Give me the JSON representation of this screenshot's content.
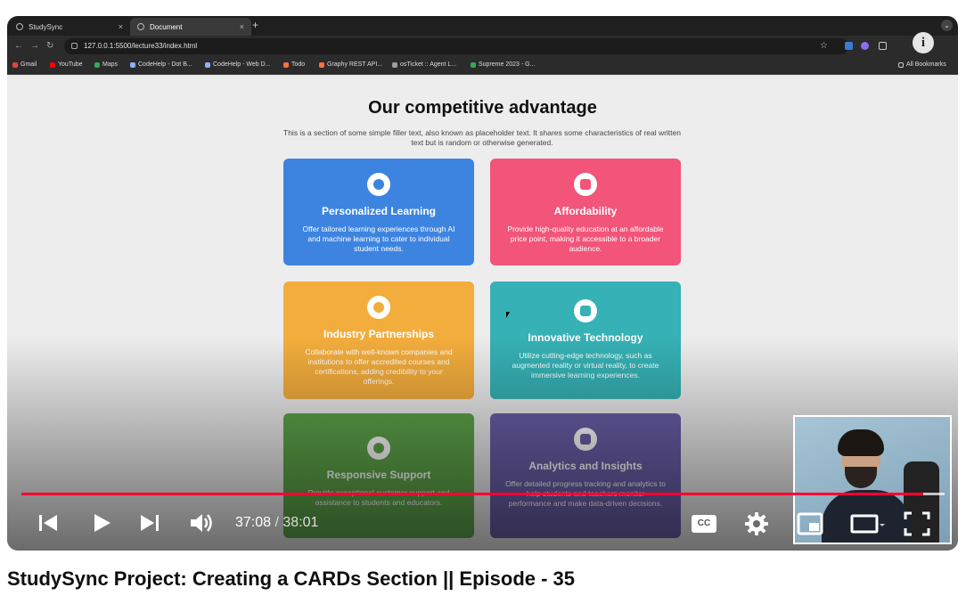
{
  "browser": {
    "tabs": [
      {
        "label": "StudySync",
        "close": "×"
      },
      {
        "label": "Document",
        "close": "×"
      }
    ],
    "new_tab": "+",
    "tab_menu": "⌄",
    "url": "127.0.0.1:5500/lecture33/index.html",
    "bookmarks": [
      {
        "label": "Gmail",
        "color": "#ea4335"
      },
      {
        "label": "YouTube",
        "color": "#ff0000"
      },
      {
        "label": "Maps",
        "color": "#34a853"
      },
      {
        "label": "CodeHelp - Dot B...",
        "color": "#8ab4f8"
      },
      {
        "label": "CodeHelp - Web D...",
        "color": "#8ab4f8"
      },
      {
        "label": "Todo",
        "color": "#ff7043"
      },
      {
        "label": "Graphy REST API...",
        "color": "#ff7043"
      },
      {
        "label": "osTicket :: Agent L...",
        "color": "#9e9e9e"
      },
      {
        "label": "Supreme 2023 - G...",
        "color": "#34a853"
      }
    ],
    "all_bookmarks": "All Bookmarks"
  },
  "page": {
    "heading": "Our competitive advantage",
    "subtext": "This is a section of some simple filler text, also known as placeholder text. It shares some characteristics of real written text but is random or otherwise generated.",
    "cards": [
      {
        "title": "Personalized Learning",
        "desc": "Offer tailored learning experiences through AI and machine learning to cater to individual student needs.",
        "icon": "lightbulb-icon",
        "color": "#3d84e0"
      },
      {
        "title": "Affordability",
        "desc": "Provide high-quality education at an affordable price point, making it accessible to a broader audience.",
        "icon": "money-icon",
        "color": "#f2547a"
      },
      {
        "title": "Industry Partnerships",
        "desc": "Collaborate with well-known companies and institutions to offer accredited courses and certifications, adding credibility to your offerings.",
        "icon": "handshake-icon",
        "color": "#f3ad3c"
      },
      {
        "title": "Innovative Technology",
        "desc": "Utilize cutting-edge technology, such as augmented reality or virtual reality, to create immersive learning experiences.",
        "icon": "vr-icon",
        "color": "#36b1b5"
      },
      {
        "title": "Responsive Support",
        "desc": "Provide exceptional customer support and assistance to students and educators.",
        "icon": "support-icon",
        "color": "#5ea54a"
      },
      {
        "title": "Analytics and Insights",
        "desc": "Offer detailed progress tracking and analytics to help students and teachers monitor performance and make data-driven decisions.",
        "icon": "chart-icon",
        "color": "#6a5fa8"
      }
    ]
  },
  "player": {
    "current_time": "37:08",
    "separator": " / ",
    "duration": "38:01",
    "played_fraction": 0.977,
    "buffered_fraction": 0.98,
    "accent": "#ff0033",
    "cc_label": "CC",
    "info_label": "i"
  },
  "video_title": "StudySync Project: Creating a CARDs Section || Episode - 35"
}
